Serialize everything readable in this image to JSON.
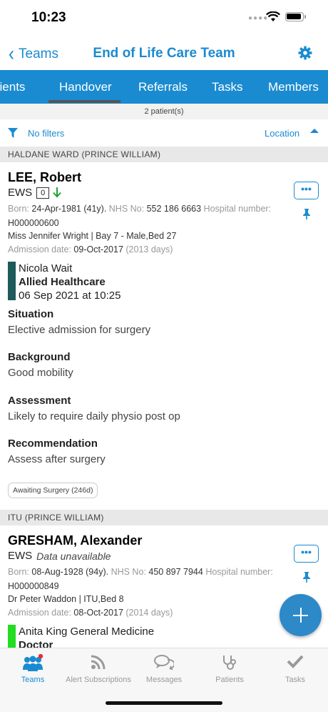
{
  "status_bar": {
    "time": "10:23"
  },
  "nav": {
    "back_label": "Teams",
    "title": "End of Life Care Team"
  },
  "tabs": [
    {
      "label": "Patients"
    },
    {
      "label": "Handover"
    },
    {
      "label": "Referrals"
    },
    {
      "label": "Tasks"
    },
    {
      "label": "Members"
    }
  ],
  "patient_count": "2 patient(s)",
  "filter": {
    "label": "No filters",
    "sort_label": "Location"
  },
  "sections": [
    {
      "header": "HALDANE WARD (PRINCE WILLIAM)",
      "patient": {
        "name": "LEE, Robert",
        "ews_label": "EWS",
        "ews_value": "0",
        "born_label": "Born:",
        "born_value": "24-Apr-1981 (41y).",
        "nhs_label": "NHS No:",
        "nhs_value": "552 186 6663",
        "hospital_label": "Hospital number:",
        "hospital_value": "H000000600",
        "consultant_location": "Miss Jennifer Wright | Bay 7 - Male,Bed 27",
        "admission_label": "Admission date:",
        "admission_value": "09-Oct-2017",
        "admission_days": "(2013 days)",
        "author_name": "Nicola Wait",
        "author_role": "Allied Healthcare",
        "author_time": "06 Sep 2021 at 10:25",
        "author_color": "#1e5a5a",
        "sbar": [
          {
            "heading": "Situation",
            "text": "Elective admission for surgery"
          },
          {
            "heading": "Background",
            "text": "Good mobility"
          },
          {
            "heading": "Assessment",
            "text": "Likely to require daily physio post op"
          },
          {
            "heading": "Recommendation",
            "text": "Assess after surgery"
          }
        ],
        "badge": "Awaiting Surgery (246d)",
        "more_label": "•••"
      }
    },
    {
      "header": "ITU (PRINCE WILLIAM)",
      "patient": {
        "name": "GRESHAM, Alexander",
        "ews_label": "EWS",
        "ews_value": "Data unavailable",
        "born_label": "Born:",
        "born_value": "08-Aug-1928 (94y).",
        "nhs_label": "NHS No:",
        "nhs_value": "450 897 7944",
        "hospital_label": "Hospital number:",
        "hospital_value": "H000000849",
        "consultant_location": "Dr Peter Waddon | ITU,Bed 8",
        "admission_label": "Admission date:",
        "admission_value": "08-Oct-2017",
        "admission_days": "(2014 days)",
        "author_name": "Anita King General Medicine",
        "author_role": "Doctor",
        "author_color": "#22dd22",
        "more_label": "•••"
      }
    }
  ],
  "bottom_tabs": [
    {
      "label": "Teams",
      "active": true
    },
    {
      "label": "Alert Subscriptions"
    },
    {
      "label": "Messages"
    },
    {
      "label": "Patients"
    },
    {
      "label": "Tasks"
    }
  ],
  "colors": {
    "accent": "#1a8bd0",
    "fab": "#2d89c8"
  }
}
